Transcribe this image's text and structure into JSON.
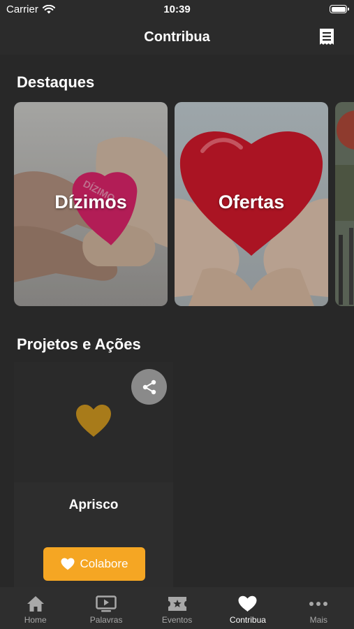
{
  "status_bar": {
    "carrier": "Carrier",
    "time": "10:39"
  },
  "nav": {
    "title": "Contribua",
    "right_icon": "receipt-icon"
  },
  "highlights": {
    "title": "Destaques",
    "cards": [
      {
        "label": "Dízimos",
        "heart_text": "DÍZIMO",
        "heart_color": "#d9246a"
      },
      {
        "label": "Ofertas",
        "heart_color": "#c8182a"
      }
    ]
  },
  "projects": {
    "title": "Projetos e Ações",
    "items": [
      {
        "name": "Aprisco",
        "button_label": "Colabore",
        "heart_color": "#a87b1a"
      }
    ]
  },
  "tabbar": {
    "items": [
      {
        "label": "Home",
        "icon": "home-icon"
      },
      {
        "label": "Palavras",
        "icon": "play-screen-icon"
      },
      {
        "label": "Eventos",
        "icon": "ticket-star-icon"
      },
      {
        "label": "Contribua",
        "icon": "heart-icon",
        "active": true
      },
      {
        "label": "Mais",
        "icon": "more-dots-icon"
      }
    ]
  },
  "colors": {
    "accent": "#f5a623",
    "background": "#282828",
    "tab_inactive": "#a8a8a8"
  }
}
